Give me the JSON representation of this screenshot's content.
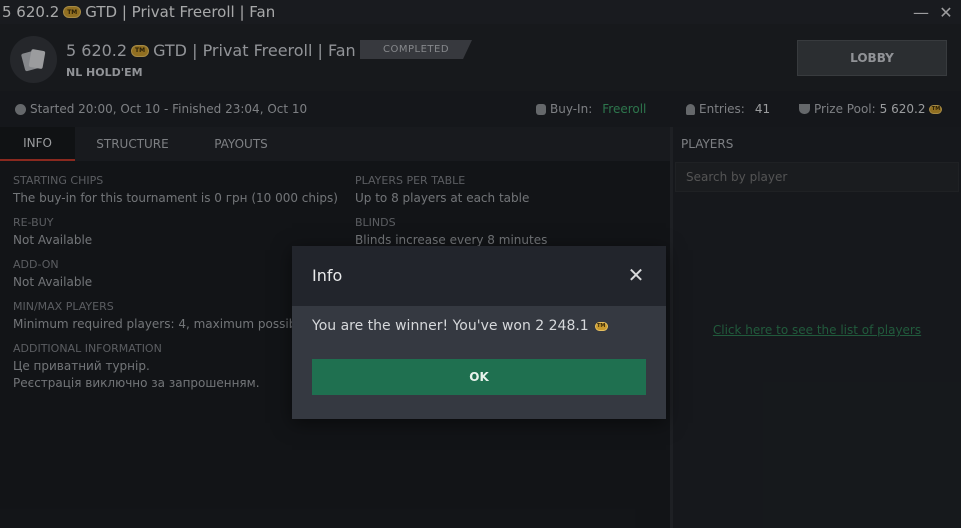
{
  "window": {
    "title_prefix": "5 620.2",
    "title_suffix": "GTD | Privat Freeroll | Fan",
    "minimize": "—",
    "close": "✕"
  },
  "header": {
    "title_prefix": "5 620.2",
    "title_suffix": "GTD | Privat Freeroll | Fan",
    "subtitle": "NL HOLD'EM",
    "status_badge": "COMPLETED",
    "lobby_button": "LOBBY"
  },
  "info_bar": {
    "times": "Started 20:00, Oct 10  -  Finished 23:04, Oct 10",
    "buyin_label": "Buy-In:",
    "buyin_value": "Freeroll",
    "entries_label": "Entries:",
    "entries_value": "41",
    "prize_label": "Prize Pool:",
    "prize_value": "5 620.2"
  },
  "tabs": [
    {
      "label": "INFO",
      "active": true
    },
    {
      "label": "STRUCTURE",
      "active": false
    },
    {
      "label": "PAYOUTS",
      "active": false
    }
  ],
  "info": {
    "starting_chips_label": "STARTING CHIPS",
    "starting_chips_value": "The buy-in for this tournament is 0 грн (10 000 chips)",
    "rebuy_label": "RE-BUY",
    "rebuy_value": "Not Available",
    "addon_label": "ADD-ON",
    "addon_value": "Not Available",
    "minmax_label": "MIN/MAX PLAYERS",
    "minmax_value": "Minimum required players: 4, maximum possible:",
    "additional_label": "ADDITIONAL INFORMATION",
    "additional_line1": "Це приватний турнір.",
    "additional_line2": "Реєстрація виключно за запрошенням.",
    "players_per_table_label": "PLAYERS PER TABLE",
    "players_per_table_value": "Up to 8 players at each table",
    "blinds_label": "BLINDS",
    "blinds_value": "Blinds increase every 8 minutes"
  },
  "players": {
    "heading": "PLAYERS",
    "search_placeholder": "Search by player",
    "link": "Click here to see the list of players"
  },
  "modal": {
    "title": "Info",
    "close": "✕",
    "message": "You are the winner! You've won 2 248.1",
    "ok_button": "OK"
  },
  "colors": {
    "accent_green": "#1f7050",
    "tab_active_underline": "#c0392b",
    "coin": "#c99a2e"
  },
  "icons": {
    "coin_text": "GTD"
  }
}
